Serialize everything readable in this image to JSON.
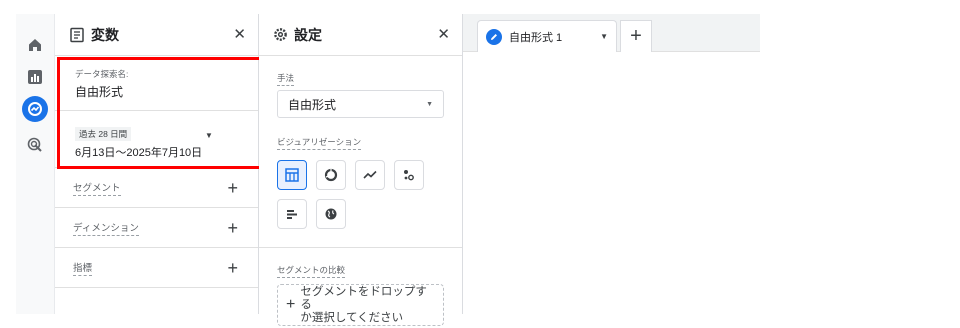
{
  "nav": {
    "items": [
      {
        "icon": "home-icon"
      },
      {
        "icon": "reports-icon"
      },
      {
        "icon": "explore-icon",
        "active": true
      },
      {
        "icon": "advertising-icon"
      }
    ]
  },
  "variables": {
    "title": "変数",
    "close": "✕",
    "exploration_name_label": "データ探索名:",
    "exploration_name": "自由形式",
    "date_range_label": "過去 28 日間",
    "date_range_value": "6月13日～2025年7月10日",
    "segments_label": "セグメント",
    "dimensions_label": "ディメンション",
    "metrics_label": "指標",
    "add": "+"
  },
  "settings": {
    "title": "設定",
    "close": "✕",
    "technique_label": "手法",
    "technique_value": "自由形式",
    "visualization_label": "ビジュアリゼーション",
    "segment_compare_label": "セグメントの比較",
    "dropzone_line1": "セグメントをドロップする",
    "dropzone_line2": "か選択してください",
    "dropzone_plus": "+"
  },
  "canvas": {
    "tab_label": "自由形式 1",
    "add_tab": "+"
  },
  "colors": {
    "accent": "#1a73e8",
    "highlight": "#ff0000"
  }
}
